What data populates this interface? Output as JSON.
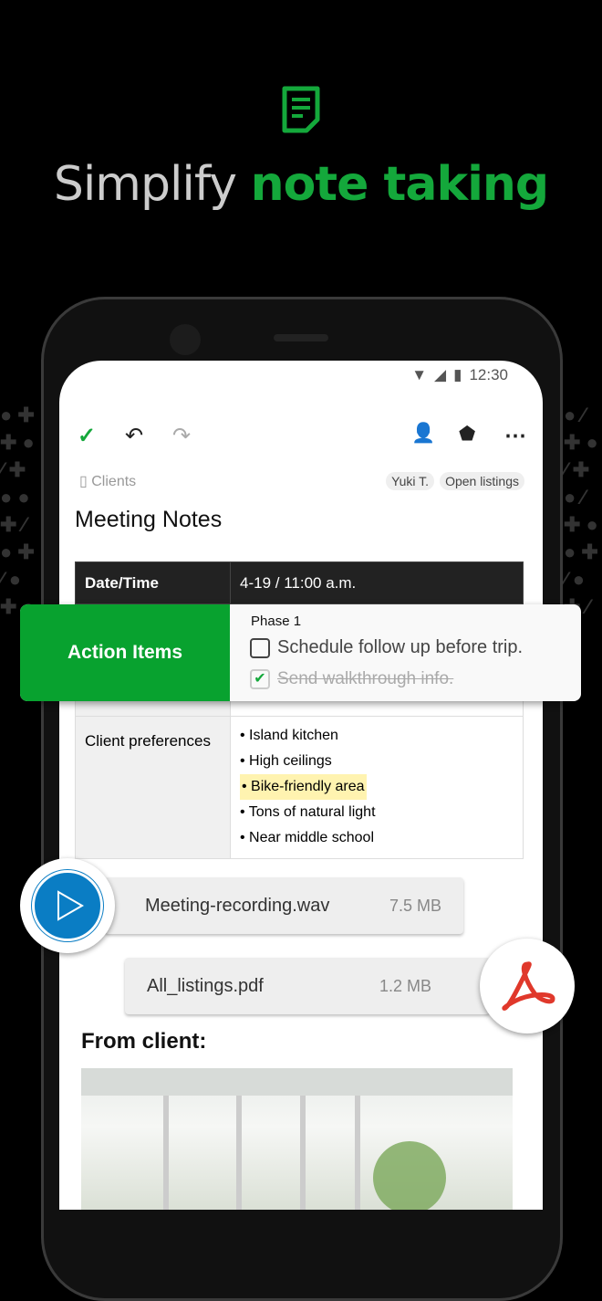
{
  "headline": {
    "part1": "Simplify ",
    "part2": "note taking"
  },
  "status_bar": {
    "time": "12:30"
  },
  "toolbar": {
    "icons": [
      "check-icon",
      "undo-icon",
      "redo-icon",
      "share-person-icon",
      "tag-add-icon",
      "more-icon"
    ]
  },
  "note": {
    "notebook": "Clients",
    "tags": [
      "Yuki T.",
      "Open listings"
    ],
    "title": "Meeting Notes"
  },
  "table": {
    "row1": {
      "label": "Date/Time",
      "value": "4-19 / 11:00 a.m."
    },
    "row2": {
      "label": "Client preferences",
      "items": [
        "Island kitchen",
        "High ceilings",
        "Bike-friendly area",
        "Tons of natural light",
        "Near middle school"
      ]
    }
  },
  "action_items": {
    "label": "Action Items",
    "heading": "Phase 1",
    "tasks": [
      {
        "text": "Schedule follow up before trip.",
        "done": false
      },
      {
        "text": "Send walkthrough info.",
        "done": true
      }
    ]
  },
  "attachments": [
    {
      "name": "Meeting-recording.wav",
      "size": "7.5 MB"
    },
    {
      "name": "All_listings.pdf",
      "size": "1.2 MB"
    }
  ],
  "section": "From client:",
  "colors": {
    "brand": "#14a83b",
    "highlight": "#fff3b0",
    "play": "#0a7dc4",
    "pdf": "#e0382b"
  }
}
